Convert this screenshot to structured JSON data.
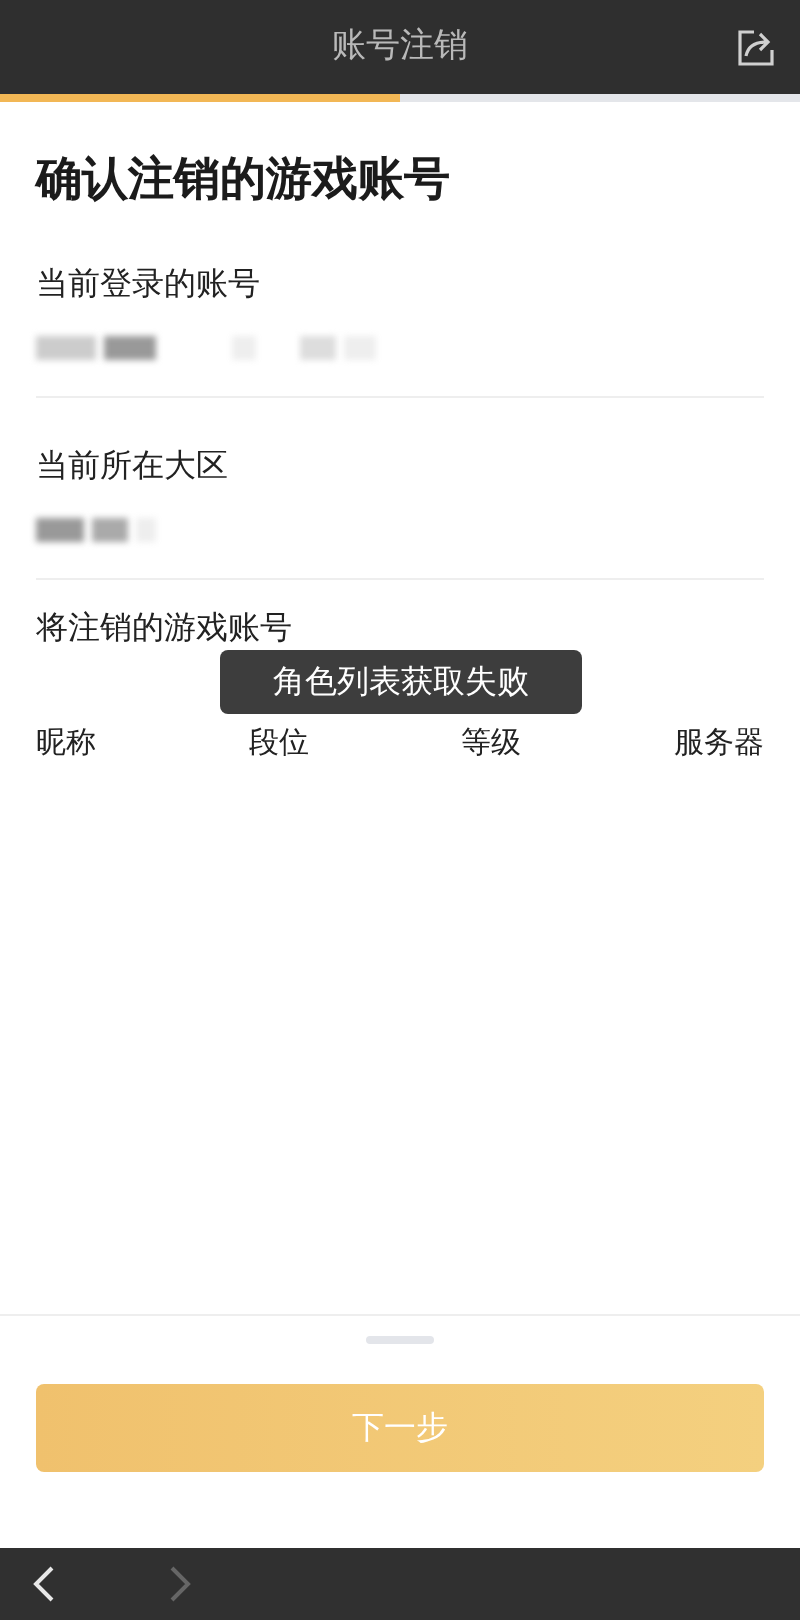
{
  "header": {
    "title": "账号注销"
  },
  "progress": {
    "level": 0.5
  },
  "page_title": "确认注销的游戏账号",
  "sections": [
    {
      "label": "当前登录的账号"
    },
    {
      "label": "当前所在大区"
    }
  ],
  "accounts": {
    "label": "将注销的游戏账号",
    "columns": [
      "昵称",
      "段位",
      "等级",
      "服务器"
    ]
  },
  "toast": "角色列表获取失败",
  "next_button": {
    "label": "下一步",
    "disabled": true
  },
  "nav": {
    "back_disabled": false,
    "forward_disabled": true
  }
}
